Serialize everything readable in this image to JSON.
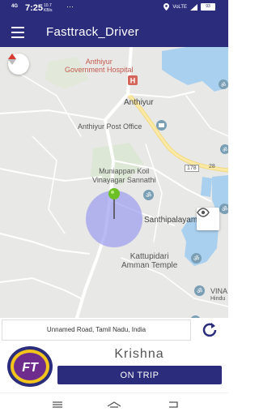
{
  "status_bar": {
    "signal": "4G",
    "time": "7:25",
    "speed": "10.7\nKB/s",
    "dots": "⋯",
    "network": "VoLTE",
    "battery": "93"
  },
  "app_bar": {
    "title": "Fasttrack_Driver"
  },
  "map": {
    "labels": {
      "hospital": "Anthiyur\nGovernment Hospital",
      "town": "Anthiyur",
      "post_office": "Anthiyur Post Office",
      "temple1": "Muniappan Koil\nVinayagar Sannathi",
      "village": "Santhipalayam",
      "temple2": "Kattupidari\nAmman Temple",
      "road_178": "178",
      "road_28": "28",
      "vina": "VINA",
      "hindu": "Hindu"
    }
  },
  "address": {
    "text": "Unnamed Road, Tamil Nadu, India"
  },
  "driver": {
    "name": "Krishna",
    "status_button": "ON TRIP",
    "logo_text": "FT"
  }
}
